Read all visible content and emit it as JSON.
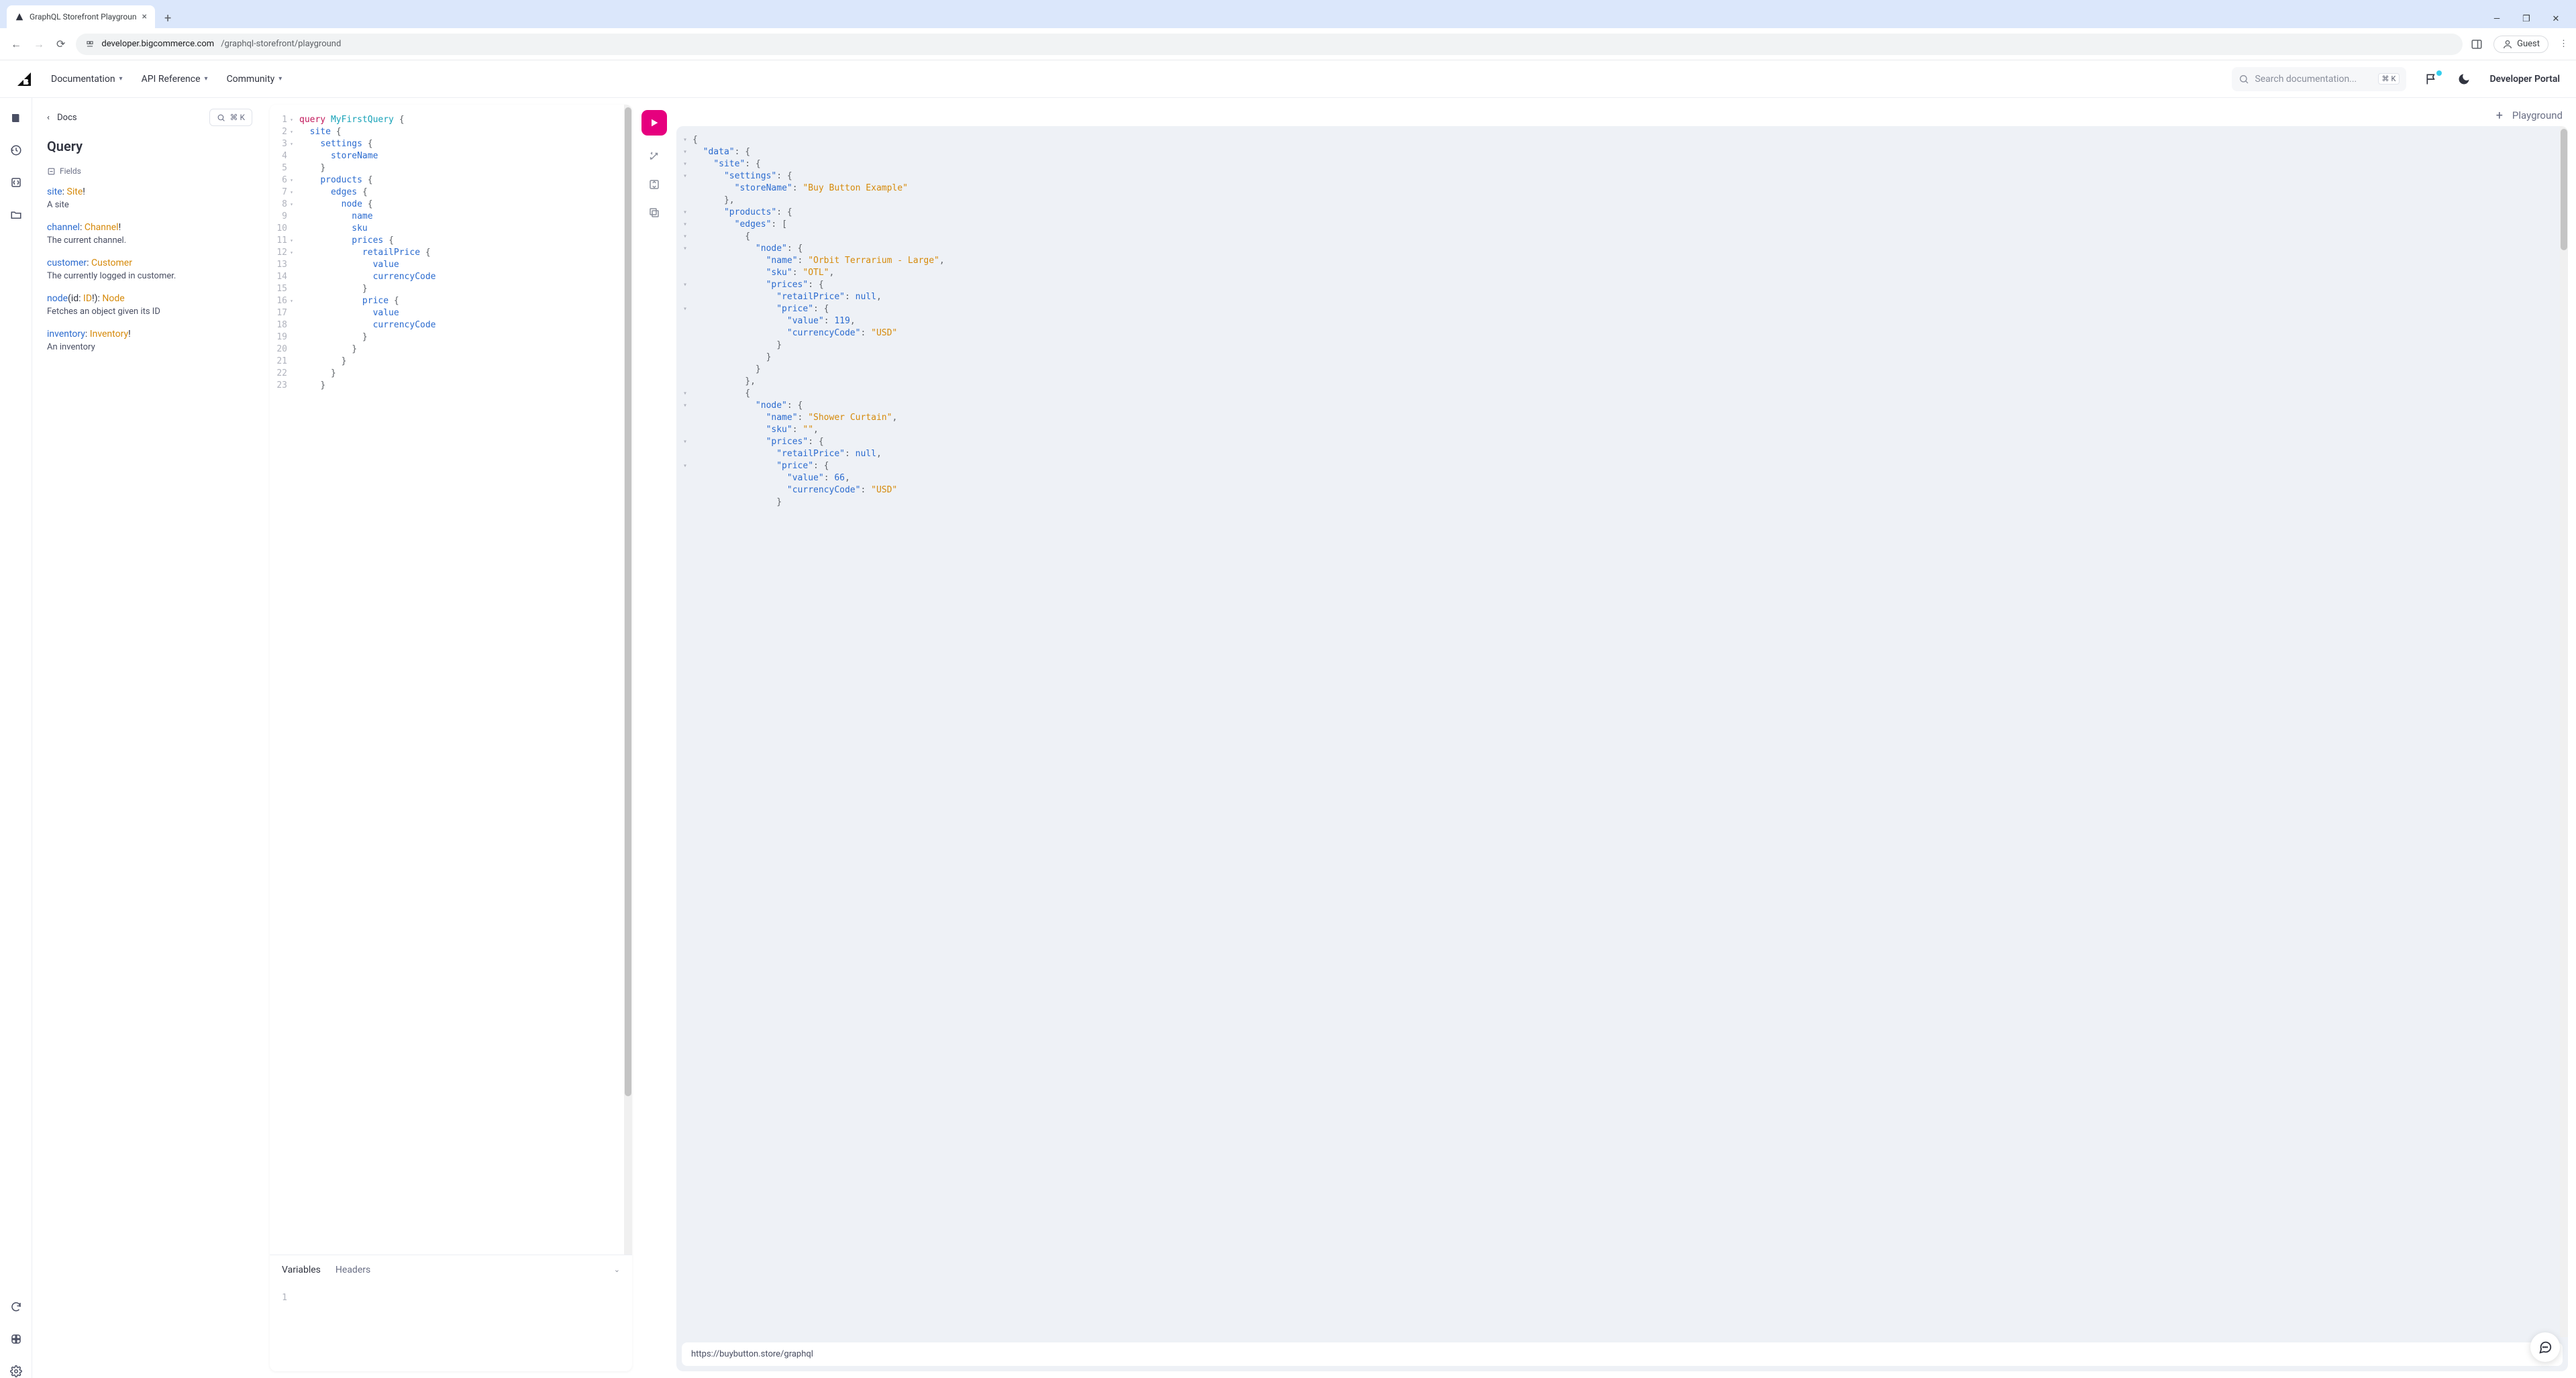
{
  "browser": {
    "tab_title": "GraphQL Storefront Playgroun",
    "url_domain": "developer.bigcommerce.com",
    "url_path": "/graphql-storefront/playground",
    "guest_label": "Guest",
    "win_min": "—",
    "win_max": "❐",
    "win_close": "✕",
    "new_tab": "+"
  },
  "header": {
    "nav": {
      "docs": "Documentation",
      "api": "API Reference",
      "community": "Community"
    },
    "search_placeholder": "Search documentation...",
    "kbd1": "⌘",
    "kbd2": "K",
    "portal": "Developer Portal"
  },
  "sidebar": {
    "back_label": "Docs",
    "shortcut_k": "⌘ K",
    "title": "Query",
    "fields_label": "Fields",
    "fields": [
      {
        "name": "site",
        "sep": ": ",
        "type": "Site",
        "bang": "!",
        "desc": "A site"
      },
      {
        "name": "channel",
        "sep": ": ",
        "type": "Channel",
        "bang": "!",
        "desc": "The current channel."
      },
      {
        "name": "customer",
        "sep": ": ",
        "type": "Customer",
        "bang": "",
        "desc": "The currently logged in customer."
      },
      {
        "name": "node",
        "sep": "(id: ",
        "type": "ID",
        "bang": "!): ",
        "type2": "Node",
        "desc": "Fetches an object given its ID"
      },
      {
        "name": "inventory",
        "sep": ": ",
        "type": "Inventory",
        "bang": "!",
        "desc": "An inventory"
      }
    ]
  },
  "editor": {
    "lines": [
      {
        "n": "1",
        "fold": true,
        "txt": [
          [
            "kw",
            "query"
          ],
          [
            "pn",
            " "
          ],
          [
            "op",
            "MyFirstQuery"
          ],
          [
            "pn",
            " "
          ],
          [
            "brace",
            "{"
          ]
        ]
      },
      {
        "n": "2",
        "fold": true,
        "txt": [
          [
            "pn",
            "  "
          ],
          [
            "fld",
            "site"
          ],
          [
            "pn",
            " "
          ],
          [
            "brace",
            "{"
          ]
        ]
      },
      {
        "n": "3",
        "fold": true,
        "txt": [
          [
            "pn",
            "    "
          ],
          [
            "fld",
            "settings"
          ],
          [
            "pn",
            " "
          ],
          [
            "brace",
            "{"
          ]
        ]
      },
      {
        "n": "4",
        "fold": false,
        "txt": [
          [
            "pn",
            "      "
          ],
          [
            "fld",
            "storeName"
          ]
        ]
      },
      {
        "n": "5",
        "fold": false,
        "txt": [
          [
            "pn",
            "    "
          ],
          [
            "brace",
            "}"
          ]
        ]
      },
      {
        "n": "6",
        "fold": true,
        "txt": [
          [
            "pn",
            "    "
          ],
          [
            "fld",
            "products"
          ],
          [
            "pn",
            " "
          ],
          [
            "brace",
            "{"
          ]
        ]
      },
      {
        "n": "7",
        "fold": true,
        "txt": [
          [
            "pn",
            "      "
          ],
          [
            "fld",
            "edges"
          ],
          [
            "pn",
            " "
          ],
          [
            "brace",
            "{"
          ]
        ]
      },
      {
        "n": "8",
        "fold": true,
        "txt": [
          [
            "pn",
            "        "
          ],
          [
            "fld",
            "node"
          ],
          [
            "pn",
            " "
          ],
          [
            "brace",
            "{"
          ]
        ]
      },
      {
        "n": "9",
        "fold": false,
        "txt": [
          [
            "pn",
            "          "
          ],
          [
            "fld",
            "name"
          ]
        ]
      },
      {
        "n": "10",
        "fold": false,
        "txt": [
          [
            "pn",
            "          "
          ],
          [
            "fld",
            "sku"
          ]
        ]
      },
      {
        "n": "11",
        "fold": true,
        "txt": [
          [
            "pn",
            "          "
          ],
          [
            "fld",
            "prices"
          ],
          [
            "pn",
            " "
          ],
          [
            "brace",
            "{"
          ]
        ]
      },
      {
        "n": "12",
        "fold": true,
        "txt": [
          [
            "pn",
            "            "
          ],
          [
            "fld",
            "retailPrice"
          ],
          [
            "pn",
            " "
          ],
          [
            "brace",
            "{"
          ]
        ]
      },
      {
        "n": "13",
        "fold": false,
        "txt": [
          [
            "pn",
            "              "
          ],
          [
            "fld",
            "value"
          ]
        ]
      },
      {
        "n": "14",
        "fold": false,
        "txt": [
          [
            "pn",
            "              "
          ],
          [
            "fld",
            "currencyCode"
          ]
        ]
      },
      {
        "n": "15",
        "fold": false,
        "txt": [
          [
            "pn",
            "            "
          ],
          [
            "brace",
            "}"
          ]
        ]
      },
      {
        "n": "16",
        "fold": true,
        "txt": [
          [
            "pn",
            "            "
          ],
          [
            "fld",
            "price"
          ],
          [
            "pn",
            " "
          ],
          [
            "brace",
            "{"
          ]
        ]
      },
      {
        "n": "17",
        "fold": false,
        "txt": [
          [
            "pn",
            "              "
          ],
          [
            "fld",
            "value"
          ]
        ]
      },
      {
        "n": "18",
        "fold": false,
        "txt": [
          [
            "pn",
            "              "
          ],
          [
            "fld",
            "currencyCode"
          ]
        ]
      },
      {
        "n": "19",
        "fold": false,
        "txt": [
          [
            "pn",
            "            "
          ],
          [
            "brace",
            "}"
          ]
        ]
      },
      {
        "n": "20",
        "fold": false,
        "txt": [
          [
            "pn",
            "          "
          ],
          [
            "brace",
            "}"
          ]
        ]
      },
      {
        "n": "21",
        "fold": false,
        "txt": [
          [
            "pn",
            "        "
          ],
          [
            "brace",
            "}"
          ]
        ]
      },
      {
        "n": "22",
        "fold": false,
        "txt": [
          [
            "pn",
            "      "
          ],
          [
            "brace",
            "}"
          ]
        ]
      },
      {
        "n": "23",
        "fold": false,
        "txt": [
          [
            "pn",
            "    "
          ],
          [
            "brace",
            "}"
          ]
        ]
      }
    ],
    "tabs": {
      "variables": "Variables",
      "headers": "Headers"
    },
    "var_line": "1"
  },
  "playground_tab": {
    "plus": "+",
    "label": "Playground"
  },
  "response": {
    "lines": [
      {
        "f": true,
        "t": [
          [
            "jpn",
            "{"
          ]
        ]
      },
      {
        "f": true,
        "t": [
          [
            "jpn",
            "  "
          ],
          [
            "jkey",
            "\"data\""
          ],
          [
            "jpn",
            ": {"
          ]
        ]
      },
      {
        "f": true,
        "t": [
          [
            "jpn",
            "    "
          ],
          [
            "jkey",
            "\"site\""
          ],
          [
            "jpn",
            ": {"
          ]
        ]
      },
      {
        "f": true,
        "t": [
          [
            "jpn",
            "      "
          ],
          [
            "jkey",
            "\"settings\""
          ],
          [
            "jpn",
            ": {"
          ]
        ]
      },
      {
        "f": false,
        "t": [
          [
            "jpn",
            "        "
          ],
          [
            "jkey",
            "\"storeName\""
          ],
          [
            "jpn",
            ": "
          ],
          [
            "jstr",
            "\"Buy Button Example\""
          ]
        ]
      },
      {
        "f": false,
        "t": [
          [
            "jpn",
            "      },"
          ]
        ]
      },
      {
        "f": true,
        "t": [
          [
            "jpn",
            "      "
          ],
          [
            "jkey",
            "\"products\""
          ],
          [
            "jpn",
            ": {"
          ]
        ]
      },
      {
        "f": true,
        "t": [
          [
            "jpn",
            "        "
          ],
          [
            "jkey",
            "\"edges\""
          ],
          [
            "jpn",
            ": ["
          ]
        ]
      },
      {
        "f": true,
        "t": [
          [
            "jpn",
            "          {"
          ]
        ]
      },
      {
        "f": true,
        "t": [
          [
            "jpn",
            "            "
          ],
          [
            "jkey",
            "\"node\""
          ],
          [
            "jpn",
            ": {"
          ]
        ]
      },
      {
        "f": false,
        "t": [
          [
            "jpn",
            "              "
          ],
          [
            "jkey",
            "\"name\""
          ],
          [
            "jpn",
            ": "
          ],
          [
            "jstr",
            "\"Orbit Terrarium - Large\""
          ],
          [
            "jpn",
            ","
          ]
        ]
      },
      {
        "f": false,
        "t": [
          [
            "jpn",
            "              "
          ],
          [
            "jkey",
            "\"sku\""
          ],
          [
            "jpn",
            ": "
          ],
          [
            "jstr",
            "\"OTL\""
          ],
          [
            "jpn",
            ","
          ]
        ]
      },
      {
        "f": true,
        "t": [
          [
            "jpn",
            "              "
          ],
          [
            "jkey",
            "\"prices\""
          ],
          [
            "jpn",
            ": {"
          ]
        ]
      },
      {
        "f": false,
        "t": [
          [
            "jpn",
            "                "
          ],
          [
            "jkey",
            "\"retailPrice\""
          ],
          [
            "jpn",
            ": "
          ],
          [
            "jnull",
            "null"
          ],
          [
            "jpn",
            ","
          ]
        ]
      },
      {
        "f": true,
        "t": [
          [
            "jpn",
            "                "
          ],
          [
            "jkey",
            "\"price\""
          ],
          [
            "jpn",
            ": {"
          ]
        ]
      },
      {
        "f": false,
        "t": [
          [
            "jpn",
            "                  "
          ],
          [
            "jkey",
            "\"value\""
          ],
          [
            "jpn",
            ": "
          ],
          [
            "jnum",
            "119"
          ],
          [
            "jpn",
            ","
          ]
        ]
      },
      {
        "f": false,
        "t": [
          [
            "jpn",
            "                  "
          ],
          [
            "jkey",
            "\"currencyCode\""
          ],
          [
            "jpn",
            ": "
          ],
          [
            "jstr",
            "\"USD\""
          ]
        ]
      },
      {
        "f": false,
        "t": [
          [
            "jpn",
            "                }"
          ]
        ]
      },
      {
        "f": false,
        "t": [
          [
            "jpn",
            "              }"
          ]
        ]
      },
      {
        "f": false,
        "t": [
          [
            "jpn",
            "            }"
          ]
        ]
      },
      {
        "f": false,
        "t": [
          [
            "jpn",
            "          },"
          ]
        ]
      },
      {
        "f": true,
        "t": [
          [
            "jpn",
            "          {"
          ]
        ]
      },
      {
        "f": true,
        "t": [
          [
            "jpn",
            "            "
          ],
          [
            "jkey",
            "\"node\""
          ],
          [
            "jpn",
            ": {"
          ]
        ]
      },
      {
        "f": false,
        "t": [
          [
            "jpn",
            "              "
          ],
          [
            "jkey",
            "\"name\""
          ],
          [
            "jpn",
            ": "
          ],
          [
            "jstr",
            "\"Shower Curtain\""
          ],
          [
            "jpn",
            ","
          ]
        ]
      },
      {
        "f": false,
        "t": [
          [
            "jpn",
            "              "
          ],
          [
            "jkey",
            "\"sku\""
          ],
          [
            "jpn",
            ": "
          ],
          [
            "jstr",
            "\"\""
          ],
          [
            "jpn",
            ","
          ]
        ]
      },
      {
        "f": true,
        "t": [
          [
            "jpn",
            "              "
          ],
          [
            "jkey",
            "\"prices\""
          ],
          [
            "jpn",
            ": {"
          ]
        ]
      },
      {
        "f": false,
        "t": [
          [
            "jpn",
            "                "
          ],
          [
            "jkey",
            "\"retailPrice\""
          ],
          [
            "jpn",
            ": "
          ],
          [
            "jnull",
            "null"
          ],
          [
            "jpn",
            ","
          ]
        ]
      },
      {
        "f": true,
        "t": [
          [
            "jpn",
            "                "
          ],
          [
            "jkey",
            "\"price\""
          ],
          [
            "jpn",
            ": {"
          ]
        ]
      },
      {
        "f": false,
        "t": [
          [
            "jpn",
            "                  "
          ],
          [
            "jkey",
            "\"value\""
          ],
          [
            "jpn",
            ": "
          ],
          [
            "jnum",
            "66"
          ],
          [
            "jpn",
            ","
          ]
        ]
      },
      {
        "f": false,
        "t": [
          [
            "jpn",
            "                  "
          ],
          [
            "jkey",
            "\"currencyCode\""
          ],
          [
            "jpn",
            ": "
          ],
          [
            "jstr",
            "\"USD\""
          ]
        ]
      },
      {
        "f": false,
        "t": [
          [
            "jpn",
            "                }"
          ]
        ]
      }
    ],
    "endpoint": "https://buybutton.store/graphql"
  }
}
